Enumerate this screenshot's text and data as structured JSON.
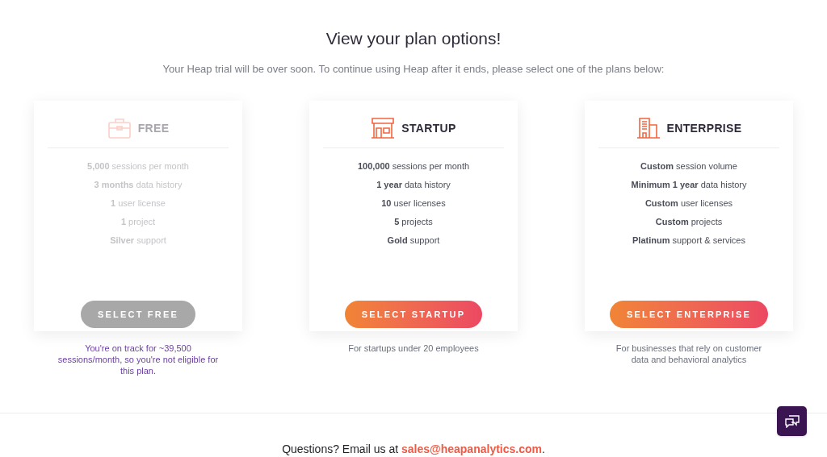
{
  "heading": "View your plan options!",
  "subheading": "Your Heap trial will be over soon. To continue using Heap after it ends, please select one of the plans below:",
  "plans": [
    {
      "name": "FREE",
      "disabled": true,
      "features": [
        "**5,000** sessions per month",
        "**3 months** data history",
        "**1** user license",
        "**1** project",
        "**Silver** support"
      ],
      "button": "SELECT FREE",
      "note": {
        "kind": "warning",
        "text": "You're on track for ~39,500 sessions/month, so you're not eligible for this plan."
      }
    },
    {
      "name": "STARTUP",
      "disabled": false,
      "features": [
        "**100,000** sessions per month",
        "**1 year** data history",
        "**10** user licenses",
        "**5** projects",
        "**Gold** support"
      ],
      "button": "SELECT STARTUP",
      "note": {
        "kind": "info",
        "text": "For startups under 20 employees"
      }
    },
    {
      "name": "ENTERPRISE",
      "disabled": false,
      "features": [
        "**Custom** session volume",
        "**Minimum 1 year** data history",
        "**Custom** user licenses",
        "**Custom** projects",
        "**Platinum** support & services"
      ],
      "button": "SELECT ENTERPRISE",
      "note": {
        "kind": "info",
        "text": "For businesses that rely on customer data and behavioral analytics"
      }
    }
  ],
  "footer": {
    "text": "Questions? Email us at ",
    "link": "sales@heapanalytics.com",
    "after": "."
  }
}
